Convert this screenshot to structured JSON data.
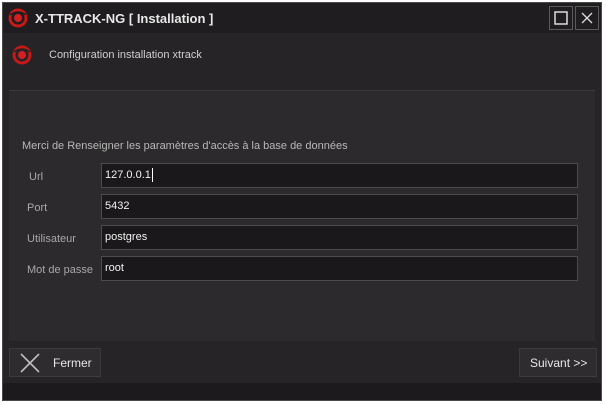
{
  "window": {
    "title": "X-TTRACK-NG [ Installation  ]",
    "subtitle": "Configuration installation xtrack",
    "accent": "#d42020"
  },
  "form": {
    "intro": "Merci de Renseigner les paramètres d'accès à la base de données",
    "url_label": "Url",
    "url_value": "127.0.0.1",
    "port_label": "Port",
    "port_value": "5432",
    "user_label": "Utilisateur",
    "user_value": "postgres",
    "password_label": "Mot de passe",
    "password_value": "root"
  },
  "footer": {
    "close_label": "Fermer",
    "next_label": "Suivant >>"
  },
  "icons": {
    "app": "app-logo-icon",
    "maximize": "maximize-icon",
    "close": "close-icon",
    "close_button": "x-close-icon"
  }
}
